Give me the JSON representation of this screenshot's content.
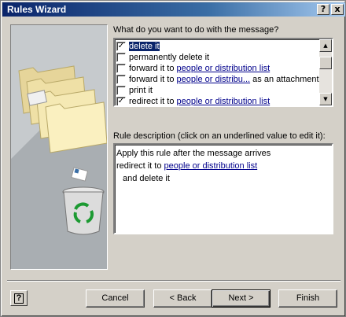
{
  "window": {
    "title": "Rules Wizard",
    "help_btn": "?",
    "close_btn": "x"
  },
  "question": "What do you want to do with the message?",
  "actions": [
    {
      "checked": true,
      "selected": true,
      "pre": "delete it",
      "link": "",
      "post": ""
    },
    {
      "checked": false,
      "selected": false,
      "pre": "permanently delete it",
      "link": "",
      "post": ""
    },
    {
      "checked": false,
      "selected": false,
      "pre": "forward it to ",
      "link": "people or distribution list",
      "post": ""
    },
    {
      "checked": false,
      "selected": false,
      "pre": "forward it to ",
      "link": "people or distribu...",
      "post": " as an attachment"
    },
    {
      "checked": false,
      "selected": false,
      "pre": "print it",
      "link": "",
      "post": ""
    },
    {
      "checked": true,
      "selected": false,
      "pre": "redirect it to ",
      "link": "people or distribution list",
      "post": ""
    }
  ],
  "check_glyph": "✓",
  "description_label": "Rule description (click on an underlined value to edit it):",
  "description": {
    "line1": "Apply this rule after the message arrives",
    "line2_pre": "redirect it to ",
    "line2_link": "people or distribution list",
    "line3": "and delete it"
  },
  "buttons": {
    "cancel": "Cancel",
    "back": "< Back",
    "next": "Next >",
    "finish": "Finish",
    "help": "?"
  },
  "icons": {
    "envelope": "envelope-icon",
    "recycle": "recycle-bin-icon",
    "scroll_up": "▲",
    "scroll_down": "▼"
  }
}
